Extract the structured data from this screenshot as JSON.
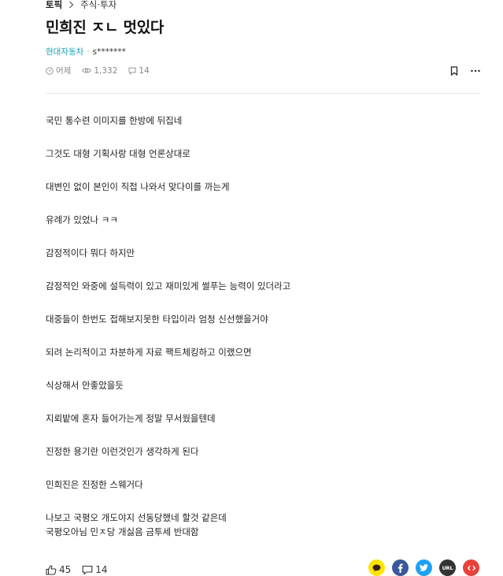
{
  "breadcrumb": {
    "main": "토픽",
    "sub": "주식·투자"
  },
  "post": {
    "title": "민희진 ㅈㄴ 멋있다",
    "company": "현대자동차",
    "author": "s*******",
    "time": "어제",
    "views": "1,332",
    "comments": "14"
  },
  "body": {
    "paragraphs": [
      "국민 통수련 이미지를 한방에 뒤집네",
      "그것도 대형 기획사랑 대형 언론상대로",
      "대변인 없이 본인이 직접 나와서 맞다이를 까는게",
      "유례가 있었나 ㅋㅋ",
      "감정적이다 뭐다 하지만",
      "감정적인 와중에 설득력이 있고 재미있게 썰푸는 능력이 있더라고",
      "대중들이 한번도 접해보지못한 타입이라 엄청 신선했을거야",
      "되려 논리적이고 차분하게 자료 팩트체킹하고 이랬으면",
      "식상해서 안좋았을듯",
      "지뢰밭에 혼자 들어가는게 정말 무서웠을텐데",
      "진정한 용기란 이런것인가 생각하게 된다",
      "민희진은 진정한 스웨거다",
      "나보고 국평오 개도야지 선동당했네 할것 같은데",
      "국평오아님 민ㅈ당 개싫음 금투세 반대함"
    ]
  },
  "footer": {
    "likes": "45",
    "comments": "14",
    "share_url_label": "URL"
  },
  "colors": {
    "company": "#1aa3b8",
    "kakao": "#fee500",
    "facebook": "#3b5998",
    "twitter": "#1da1f2",
    "url": "#333333",
    "embed": "#e8403c"
  },
  "icons": {
    "clock": "clock-icon",
    "views": "eye-icon",
    "comments": "comment-icon",
    "bookmark": "bookmark-icon",
    "more": "more-icon",
    "like": "thumbs-up-icon"
  }
}
